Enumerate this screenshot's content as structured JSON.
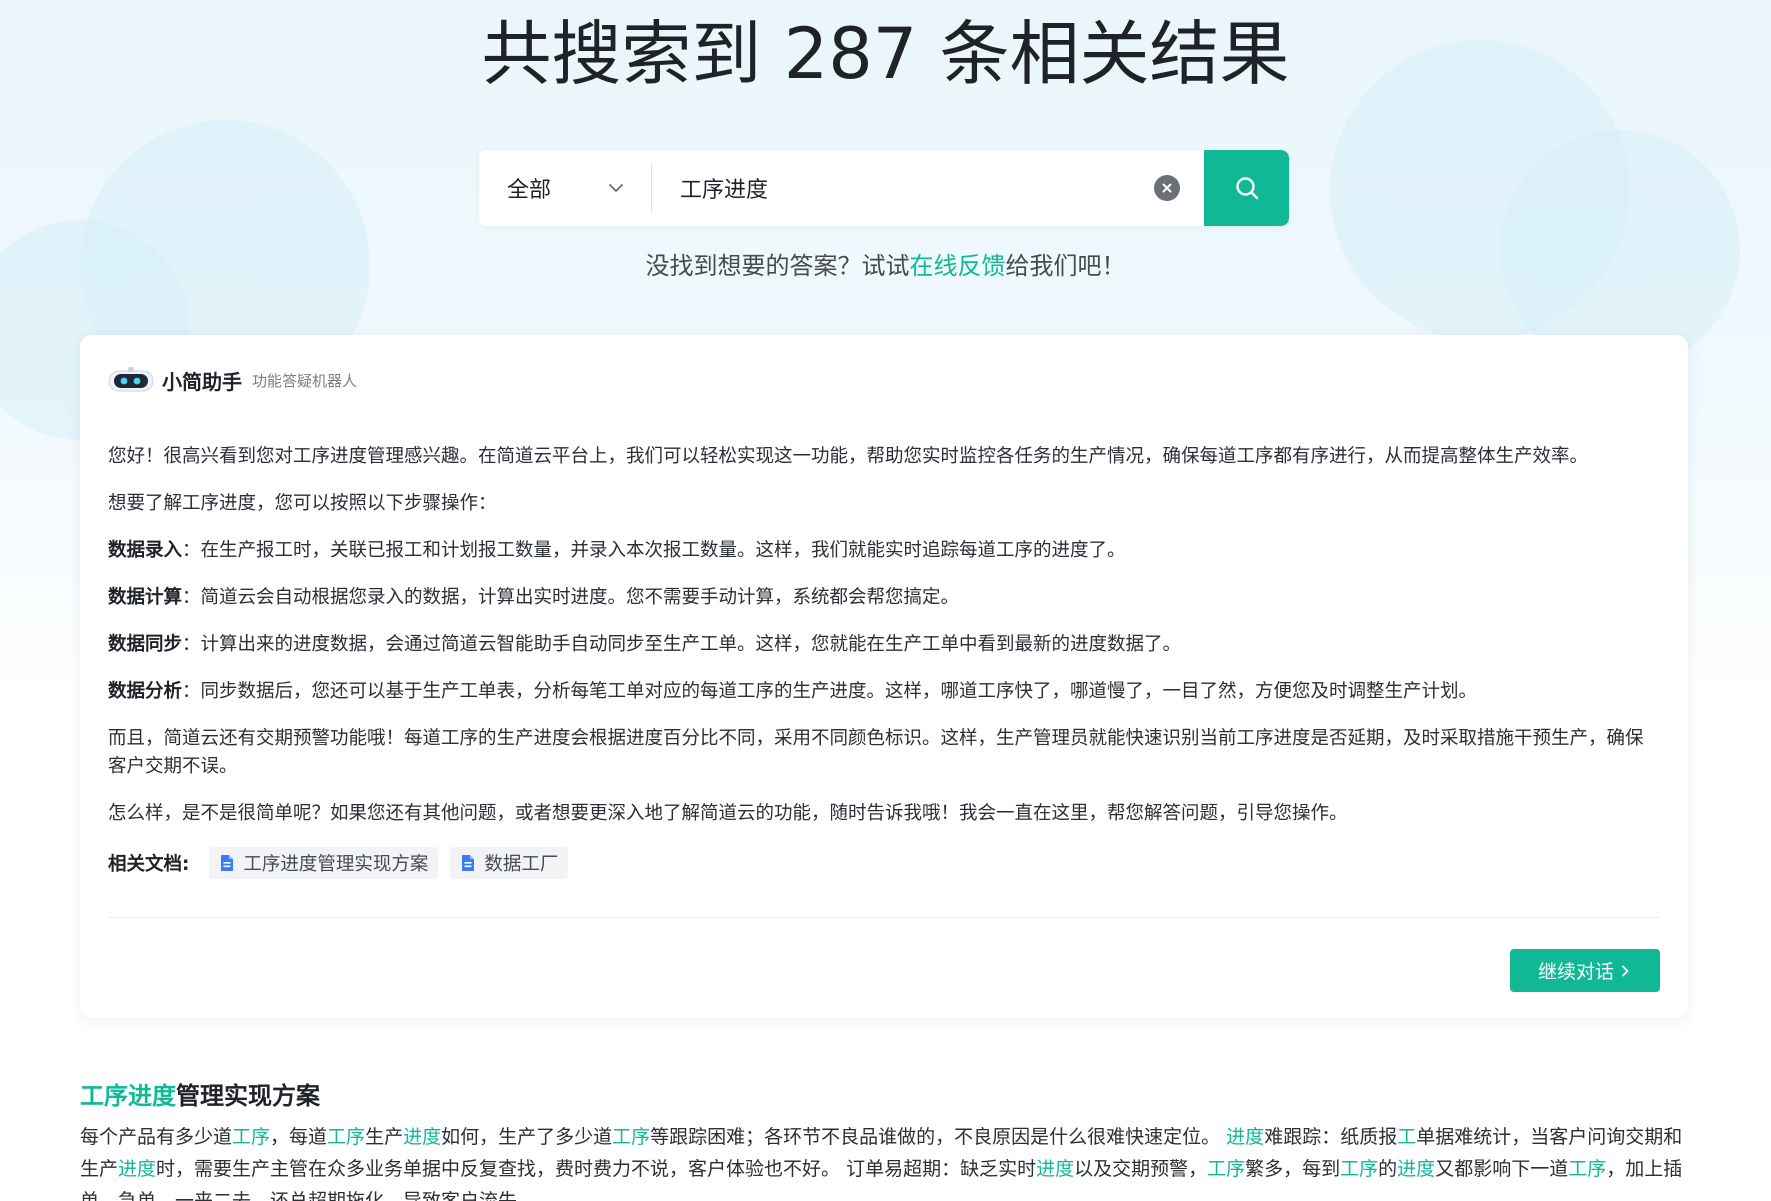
{
  "header": {
    "title": "共搜索到 287 条相关结果"
  },
  "search": {
    "scope": "全部",
    "query": "工序进度"
  },
  "feedback": {
    "prefix": "没找到想要的答案？试试",
    "link": "在线反馈",
    "suffix": "给我们吧！"
  },
  "assistant": {
    "name": "小简助手",
    "subtitle": "功能答疑机器人",
    "intro": "您好！很高兴看到您对工序进度管理感兴趣。在简道云平台上，我们可以轻松实现这一功能，帮助您实时监控各任务的生产情况，确保每道工序都有序进行，从而提高整体生产效率。",
    "steps_intro": "想要了解工序进度，您可以按照以下步骤操作：",
    "steps": [
      {
        "title": "数据录入",
        "text": "：在生产报工时，关联已报工和计划报工数量，并录入本次报工数量。这样，我们就能实时追踪每道工序的进度了。"
      },
      {
        "title": "数据计算",
        "text": "：简道云会自动根据您录入的数据，计算出实时进度。您不需要手动计算，系统都会帮您搞定。"
      },
      {
        "title": "数据同步",
        "text": "：计算出来的进度数据，会通过简道云智能助手自动同步至生产工单。这样，您就能在生产工单中看到最新的进度数据了。"
      },
      {
        "title": "数据分析",
        "text": "：同步数据后，您还可以基于生产工单表，分析每笔工单对应的每道工序的生产进度。这样，哪道工序快了，哪道慢了，一目了然，方便您及时调整生产计划。"
      }
    ],
    "extra": "而且，简道云还有交期预警功能哦！每道工序的生产进度会根据进度百分比不同，采用不同颜色标识。这样，生产管理员就能快速识别当前工序进度是否延期，及时采取措施干预生产，确保客户交期不误。",
    "closing": "怎么样，是不是很简单呢？如果您还有其他问题，或者想要更深入地了解简道云的功能，随时告诉我哦！我会一直在这里，帮您解答问题，引导您操作。",
    "related_label": "相关文档:",
    "related_docs": [
      "工序进度管理实现方案",
      "数据工厂"
    ],
    "continue_label": "继续对话"
  },
  "results": [
    {
      "title_highlight": "工序进度",
      "title_rest": "管理实现方案",
      "snippet": [
        {
          "t": "每个产品有多少道",
          "h": false
        },
        {
          "t": "工序",
          "h": true
        },
        {
          "t": "，每道",
          "h": false
        },
        {
          "t": "工序",
          "h": true
        },
        {
          "t": "生产",
          "h": false
        },
        {
          "t": "进度",
          "h": true
        },
        {
          "t": "如何，生产了多少道",
          "h": false
        },
        {
          "t": "工序",
          "h": true
        },
        {
          "t": "等跟踪困难；各环节不良品谁做的，不良原因是什么很难快速定位。 ",
          "h": false
        },
        {
          "t": "进度",
          "h": true
        },
        {
          "t": "难跟踪：纸质报",
          "h": false
        },
        {
          "t": "工",
          "h": true
        },
        {
          "t": "单据难统计，当客户问询交期和生产",
          "h": false
        },
        {
          "t": "进度",
          "h": true
        },
        {
          "t": "时，需要生产主管在众多业务单据中反复查找，费时费力不说，客户体验也不好。 订单易超期：缺乏实时",
          "h": false
        },
        {
          "t": "进度",
          "h": true
        },
        {
          "t": "以及交期预警，",
          "h": false
        },
        {
          "t": "工序",
          "h": true
        },
        {
          "t": "繁多，每到",
          "h": false
        },
        {
          "t": "工序",
          "h": true
        },
        {
          "t": "的",
          "h": false
        },
        {
          "t": "进度",
          "h": true
        },
        {
          "t": "又都影响下一道",
          "h": false
        },
        {
          "t": "工序",
          "h": true
        },
        {
          "t": "，加上插单、急单、一来二去，还总超期拖化，导致客户流失。",
          "h": false
        }
      ]
    }
  ],
  "colors": {
    "accent": "#10b896",
    "title": "#1f2329",
    "background_top": "#eaf6fc"
  },
  "icons": {
    "dropdown": "chevron-down-icon",
    "clear": "clear-circle-icon",
    "search": "search-icon",
    "doc": "document-icon",
    "continue": "chevron-right-icon",
    "avatar": "robot-avatar-icon"
  }
}
